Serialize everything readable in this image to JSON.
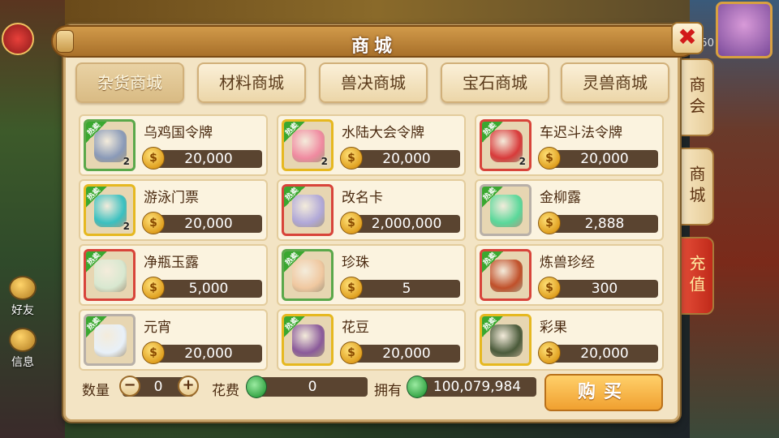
{
  "panel": {
    "title": "商城",
    "close_icon": "✖"
  },
  "categories": [
    {
      "label": "杂货商城",
      "active": true
    },
    {
      "label": "材料商城",
      "active": false
    },
    {
      "label": "兽决商城",
      "active": false
    },
    {
      "label": "宝石商城",
      "active": false
    },
    {
      "label": "灵兽商城",
      "active": false
    }
  ],
  "side_tabs": [
    {
      "label": "商会",
      "active": false
    },
    {
      "label": "商城",
      "active": false
    },
    {
      "label": "充值",
      "active": true
    }
  ],
  "hot_label": "热卖",
  "coin_glyph": "$",
  "items": [
    {
      "name": "乌鸡国令牌",
      "price": "20,000",
      "count": "2",
      "quality": "q-green",
      "icon": "token-icon",
      "color": "#8a9ab8"
    },
    {
      "name": "水陆大会令牌",
      "price": "20,000",
      "count": "2",
      "quality": "q-yellow",
      "icon": "token-icon",
      "color": "#f08aa0"
    },
    {
      "name": "车迟斗法令牌",
      "price": "20,000",
      "count": "2",
      "quality": "q-red",
      "icon": "token-icon",
      "color": "#d83a3a"
    },
    {
      "name": "游泳门票",
      "price": "20,000",
      "count": "2",
      "quality": "q-yellow",
      "icon": "ticket-icon",
      "color": "#3ac0c0"
    },
    {
      "name": "改名卡",
      "price": "2,000,000",
      "count": "",
      "quality": "q-red",
      "icon": "scroll-icon",
      "color": "#b0a8d8"
    },
    {
      "name": "金柳露",
      "price": "2,888",
      "count": "",
      "quality": "q-gray",
      "icon": "potion-icon",
      "color": "#5ad89a"
    },
    {
      "name": "净瓶玉露",
      "price": "5,000",
      "count": "",
      "quality": "q-red",
      "icon": "vase-icon",
      "color": "#d8e8d0"
    },
    {
      "name": "珍珠",
      "price": "5",
      "count": "",
      "quality": "q-green",
      "icon": "pearl-icon",
      "color": "#f0c8a0"
    },
    {
      "name": "炼兽珍经",
      "price": "300",
      "count": "",
      "quality": "q-red",
      "icon": "book-icon",
      "color": "#c0502a"
    },
    {
      "name": "元宵",
      "price": "20,000",
      "count": "",
      "quality": "q-gray",
      "icon": "ball-icon",
      "color": "#e8f0f8"
    },
    {
      "name": "花豆",
      "price": "20,000",
      "count": "",
      "quality": "q-yellow",
      "icon": "bean-icon",
      "color": "#8a5a9a"
    },
    {
      "name": "彩果",
      "price": "20,000",
      "count": "",
      "quality": "q-yellow",
      "icon": "fruit-icon",
      "color": "#4a5a3a"
    }
  ],
  "bottom": {
    "quantity_label": "数量",
    "quantity_value": "0",
    "minus": "−",
    "plus": "+",
    "cost_label": "花费",
    "cost_value": "0",
    "own_label": "拥有",
    "own_value": "100,079,984",
    "buy_label": "购买"
  },
  "left_hud": [
    {
      "label": "好友"
    },
    {
      "label": "信息"
    }
  ],
  "top_right_level": "150"
}
